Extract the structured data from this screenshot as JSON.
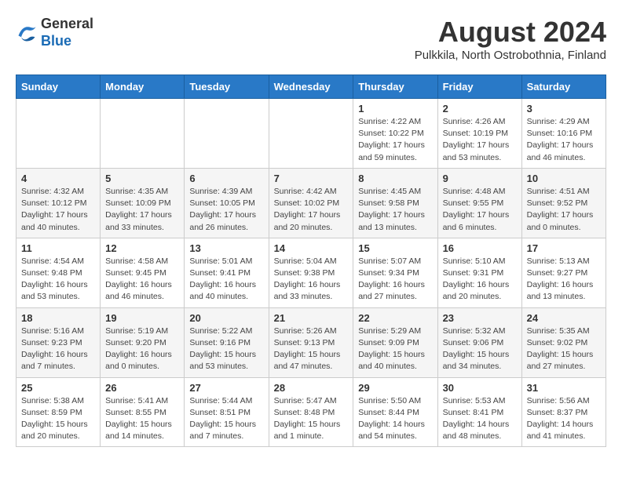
{
  "header": {
    "logo_line1": "General",
    "logo_line2": "Blue",
    "month_title": "August 2024",
    "subtitle": "Pulkkila, North Ostrobothnia, Finland"
  },
  "days_of_week": [
    "Sunday",
    "Monday",
    "Tuesday",
    "Wednesday",
    "Thursday",
    "Friday",
    "Saturday"
  ],
  "weeks": [
    [
      {
        "day": "",
        "info": ""
      },
      {
        "day": "",
        "info": ""
      },
      {
        "day": "",
        "info": ""
      },
      {
        "day": "",
        "info": ""
      },
      {
        "day": "1",
        "info": "Sunrise: 4:22 AM\nSunset: 10:22 PM\nDaylight: 17 hours\nand 59 minutes."
      },
      {
        "day": "2",
        "info": "Sunrise: 4:26 AM\nSunset: 10:19 PM\nDaylight: 17 hours\nand 53 minutes."
      },
      {
        "day": "3",
        "info": "Sunrise: 4:29 AM\nSunset: 10:16 PM\nDaylight: 17 hours\nand 46 minutes."
      }
    ],
    [
      {
        "day": "4",
        "info": "Sunrise: 4:32 AM\nSunset: 10:12 PM\nDaylight: 17 hours\nand 40 minutes."
      },
      {
        "day": "5",
        "info": "Sunrise: 4:35 AM\nSunset: 10:09 PM\nDaylight: 17 hours\nand 33 minutes."
      },
      {
        "day": "6",
        "info": "Sunrise: 4:39 AM\nSunset: 10:05 PM\nDaylight: 17 hours\nand 26 minutes."
      },
      {
        "day": "7",
        "info": "Sunrise: 4:42 AM\nSunset: 10:02 PM\nDaylight: 17 hours\nand 20 minutes."
      },
      {
        "day": "8",
        "info": "Sunrise: 4:45 AM\nSunset: 9:58 PM\nDaylight: 17 hours\nand 13 minutes."
      },
      {
        "day": "9",
        "info": "Sunrise: 4:48 AM\nSunset: 9:55 PM\nDaylight: 17 hours\nand 6 minutes."
      },
      {
        "day": "10",
        "info": "Sunrise: 4:51 AM\nSunset: 9:52 PM\nDaylight: 17 hours\nand 0 minutes."
      }
    ],
    [
      {
        "day": "11",
        "info": "Sunrise: 4:54 AM\nSunset: 9:48 PM\nDaylight: 16 hours\nand 53 minutes."
      },
      {
        "day": "12",
        "info": "Sunrise: 4:58 AM\nSunset: 9:45 PM\nDaylight: 16 hours\nand 46 minutes."
      },
      {
        "day": "13",
        "info": "Sunrise: 5:01 AM\nSunset: 9:41 PM\nDaylight: 16 hours\nand 40 minutes."
      },
      {
        "day": "14",
        "info": "Sunrise: 5:04 AM\nSunset: 9:38 PM\nDaylight: 16 hours\nand 33 minutes."
      },
      {
        "day": "15",
        "info": "Sunrise: 5:07 AM\nSunset: 9:34 PM\nDaylight: 16 hours\nand 27 minutes."
      },
      {
        "day": "16",
        "info": "Sunrise: 5:10 AM\nSunset: 9:31 PM\nDaylight: 16 hours\nand 20 minutes."
      },
      {
        "day": "17",
        "info": "Sunrise: 5:13 AM\nSunset: 9:27 PM\nDaylight: 16 hours\nand 13 minutes."
      }
    ],
    [
      {
        "day": "18",
        "info": "Sunrise: 5:16 AM\nSunset: 9:23 PM\nDaylight: 16 hours\nand 7 minutes."
      },
      {
        "day": "19",
        "info": "Sunrise: 5:19 AM\nSunset: 9:20 PM\nDaylight: 16 hours\nand 0 minutes."
      },
      {
        "day": "20",
        "info": "Sunrise: 5:22 AM\nSunset: 9:16 PM\nDaylight: 15 hours\nand 53 minutes."
      },
      {
        "day": "21",
        "info": "Sunrise: 5:26 AM\nSunset: 9:13 PM\nDaylight: 15 hours\nand 47 minutes."
      },
      {
        "day": "22",
        "info": "Sunrise: 5:29 AM\nSunset: 9:09 PM\nDaylight: 15 hours\nand 40 minutes."
      },
      {
        "day": "23",
        "info": "Sunrise: 5:32 AM\nSunset: 9:06 PM\nDaylight: 15 hours\nand 34 minutes."
      },
      {
        "day": "24",
        "info": "Sunrise: 5:35 AM\nSunset: 9:02 PM\nDaylight: 15 hours\nand 27 minutes."
      }
    ],
    [
      {
        "day": "25",
        "info": "Sunrise: 5:38 AM\nSunset: 8:59 PM\nDaylight: 15 hours\nand 20 minutes."
      },
      {
        "day": "26",
        "info": "Sunrise: 5:41 AM\nSunset: 8:55 PM\nDaylight: 15 hours\nand 14 minutes."
      },
      {
        "day": "27",
        "info": "Sunrise: 5:44 AM\nSunset: 8:51 PM\nDaylight: 15 hours\nand 7 minutes."
      },
      {
        "day": "28",
        "info": "Sunrise: 5:47 AM\nSunset: 8:48 PM\nDaylight: 15 hours\nand 1 minute."
      },
      {
        "day": "29",
        "info": "Sunrise: 5:50 AM\nSunset: 8:44 PM\nDaylight: 14 hours\nand 54 minutes."
      },
      {
        "day": "30",
        "info": "Sunrise: 5:53 AM\nSunset: 8:41 PM\nDaylight: 14 hours\nand 48 minutes."
      },
      {
        "day": "31",
        "info": "Sunrise: 5:56 AM\nSunset: 8:37 PM\nDaylight: 14 hours\nand 41 minutes."
      }
    ]
  ]
}
